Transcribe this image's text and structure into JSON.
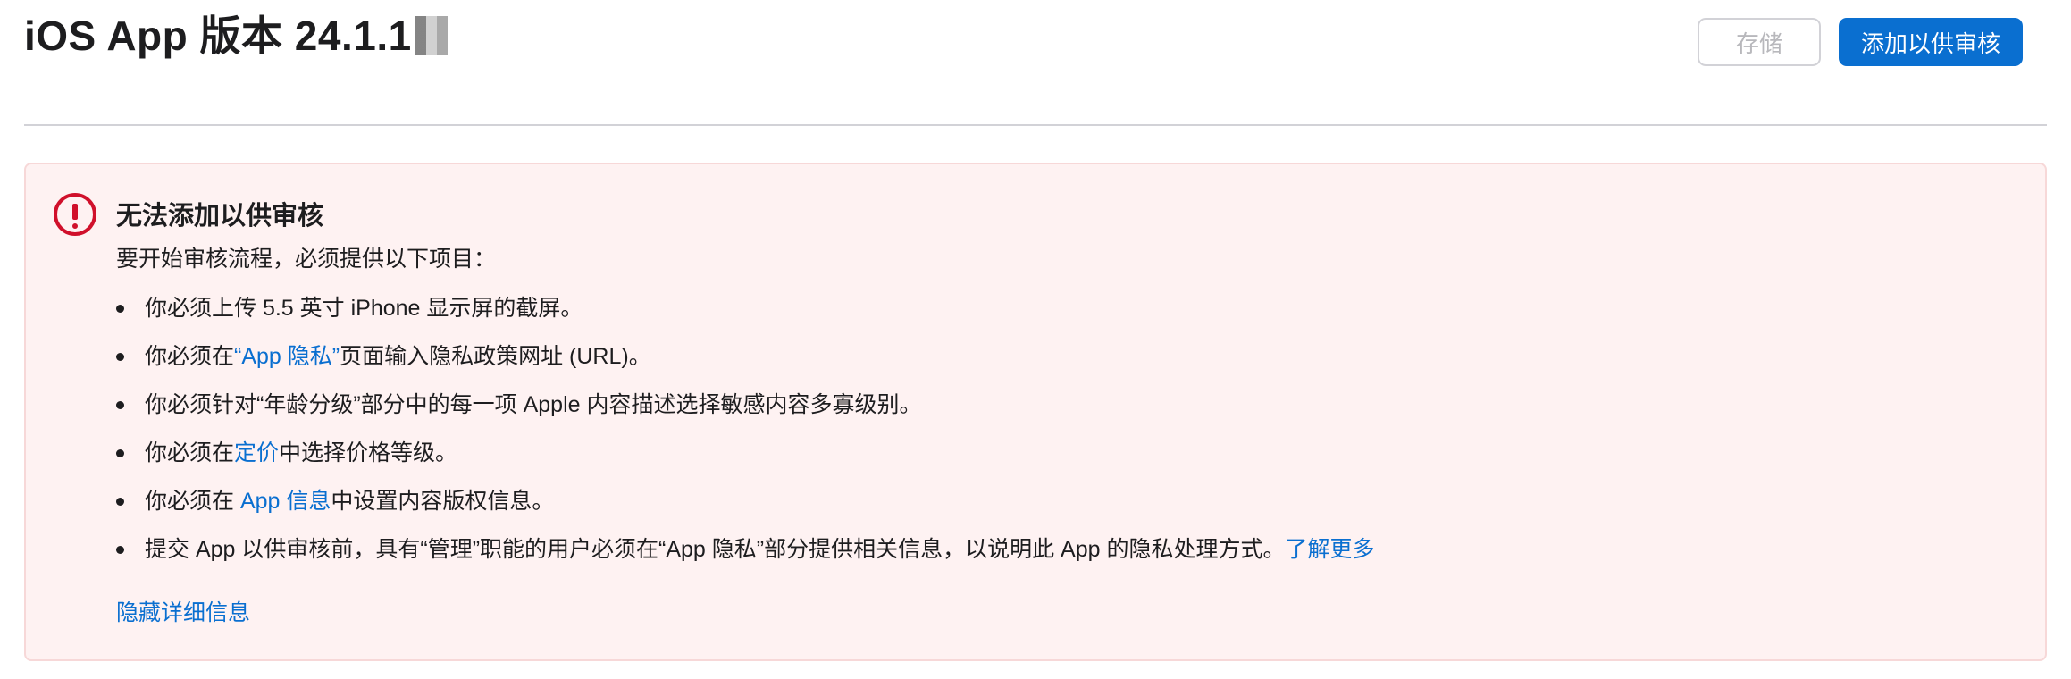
{
  "header": {
    "title": "iOS App 版本 24.1.1",
    "save_label": "存储",
    "submit_label": "添加以供审核"
  },
  "alert": {
    "icon": "exclamation-circle-icon",
    "title": "无法添加以供审核",
    "intro": "要开始审核流程，必须提供以下项目：",
    "items": [
      {
        "before": "你必须上传 5.5 英寸 iPhone 显示屏的截屏。",
        "link": "",
        "after": ""
      },
      {
        "before": "你必须在",
        "link": "“App 隐私”",
        "after": "页面输入隐私政策网址 (URL)。"
      },
      {
        "before": "你必须针对“年龄分级”部分中的每一项 Apple 内容描述选择敏感内容多寡级别。",
        "link": "",
        "after": ""
      },
      {
        "before": "你必须在",
        "link": "定价",
        "after": "中选择价格等级。"
      },
      {
        "before": "你必须在 ",
        "link": "App 信息",
        "after": "中设置内容版权信息。"
      },
      {
        "before": "提交 App 以供审核前，具有“管理”职能的用户必须在“App 隐私”部分提供相关信息，以说明此 App 的隐私处理方式。",
        "link": "了解更多",
        "after": ""
      }
    ],
    "toggle_label": "隐藏详细信息"
  },
  "colors": {
    "accent": "#0a6fd0",
    "error": "#d0102b",
    "alert_background": "#fef2f2",
    "divider": "#d2d2d7"
  }
}
